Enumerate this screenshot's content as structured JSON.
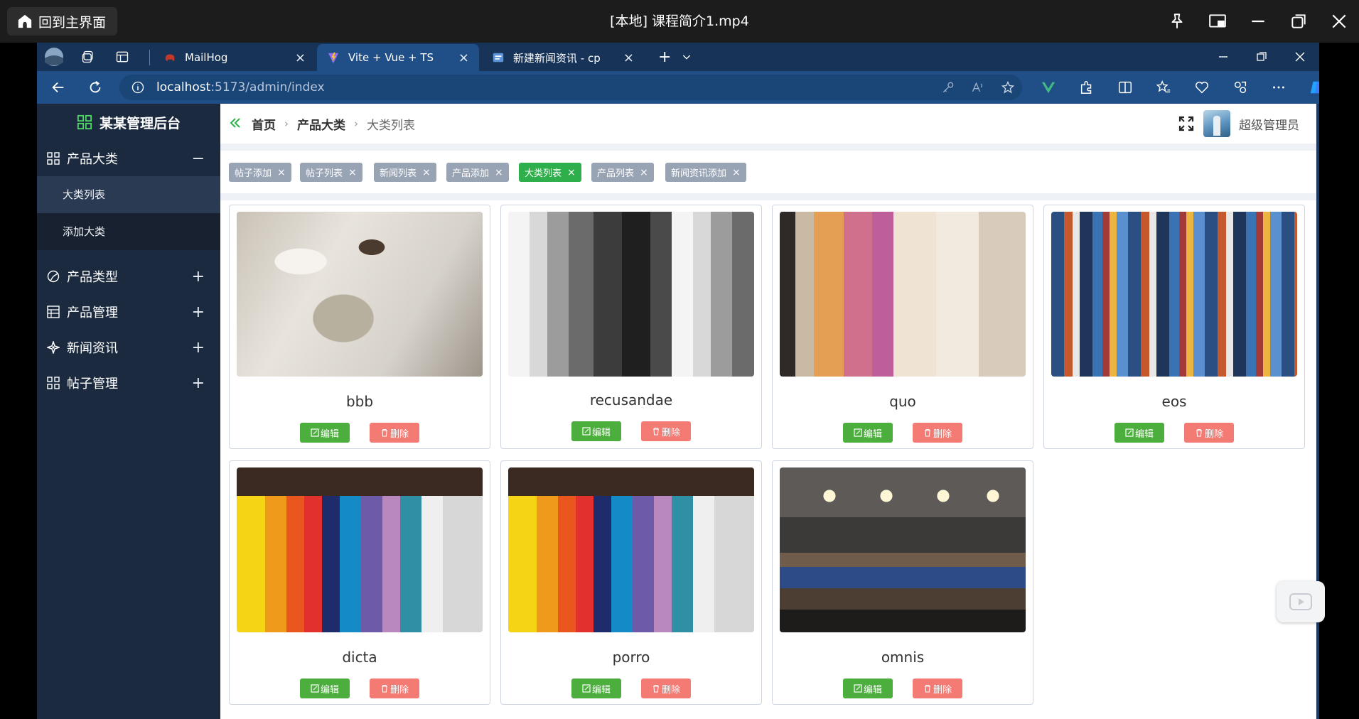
{
  "player": {
    "home_label": "回到主界面",
    "title": "[本地] 课程简介1.mp4"
  },
  "browser": {
    "tabs": [
      {
        "label": "MailHog",
        "active": false
      },
      {
        "label": "Vite + Vue + TS",
        "active": true
      },
      {
        "label": "新建新闻资讯 - cp",
        "active": false
      }
    ],
    "url_host": "localhost",
    "url_path": ":5173/admin/index"
  },
  "app": {
    "brand": "某某管理后台",
    "menu": [
      {
        "label": "产品大类",
        "toggle": "−",
        "icon": "grid-icon",
        "children": [
          {
            "label": "大类列表",
            "active": true
          },
          {
            "label": "添加大类",
            "active": false
          }
        ]
      },
      {
        "label": "产品类型",
        "toggle": "+",
        "icon": "chart-icon"
      },
      {
        "label": "产品管理",
        "toggle": "+",
        "icon": "table-icon"
      },
      {
        "label": "新闻资讯",
        "toggle": "+",
        "icon": "compass-icon"
      },
      {
        "label": "帖子管理",
        "toggle": "+",
        "icon": "grid-icon"
      }
    ],
    "breadcrumb": [
      "首页",
      "产品大类",
      "大类列表"
    ],
    "user_name": "超级管理员",
    "tags": [
      {
        "label": "帖子添加",
        "active": false
      },
      {
        "label": "帖子列表",
        "active": false
      },
      {
        "label": "新闻列表",
        "active": false
      },
      {
        "label": "产品添加",
        "active": false
      },
      {
        "label": "大类列表",
        "active": true
      },
      {
        "label": "产品列表",
        "active": false
      },
      {
        "label": "新闻资讯添加",
        "active": false
      }
    ],
    "edit_label": "编辑",
    "delete_label": "删除",
    "cards": [
      {
        "name": "bbb",
        "image": "bed-clothes"
      },
      {
        "name": "recusandae",
        "image": "gray-shirts"
      },
      {
        "name": "quo",
        "image": "warm-shirts"
      },
      {
        "name": "eos",
        "image": "clothes-rack"
      },
      {
        "name": "dicta",
        "image": "colorful-shirts"
      },
      {
        "name": "porro",
        "image": "colorful-shirts"
      },
      {
        "name": "omnis",
        "image": "clothing-store"
      }
    ]
  }
}
